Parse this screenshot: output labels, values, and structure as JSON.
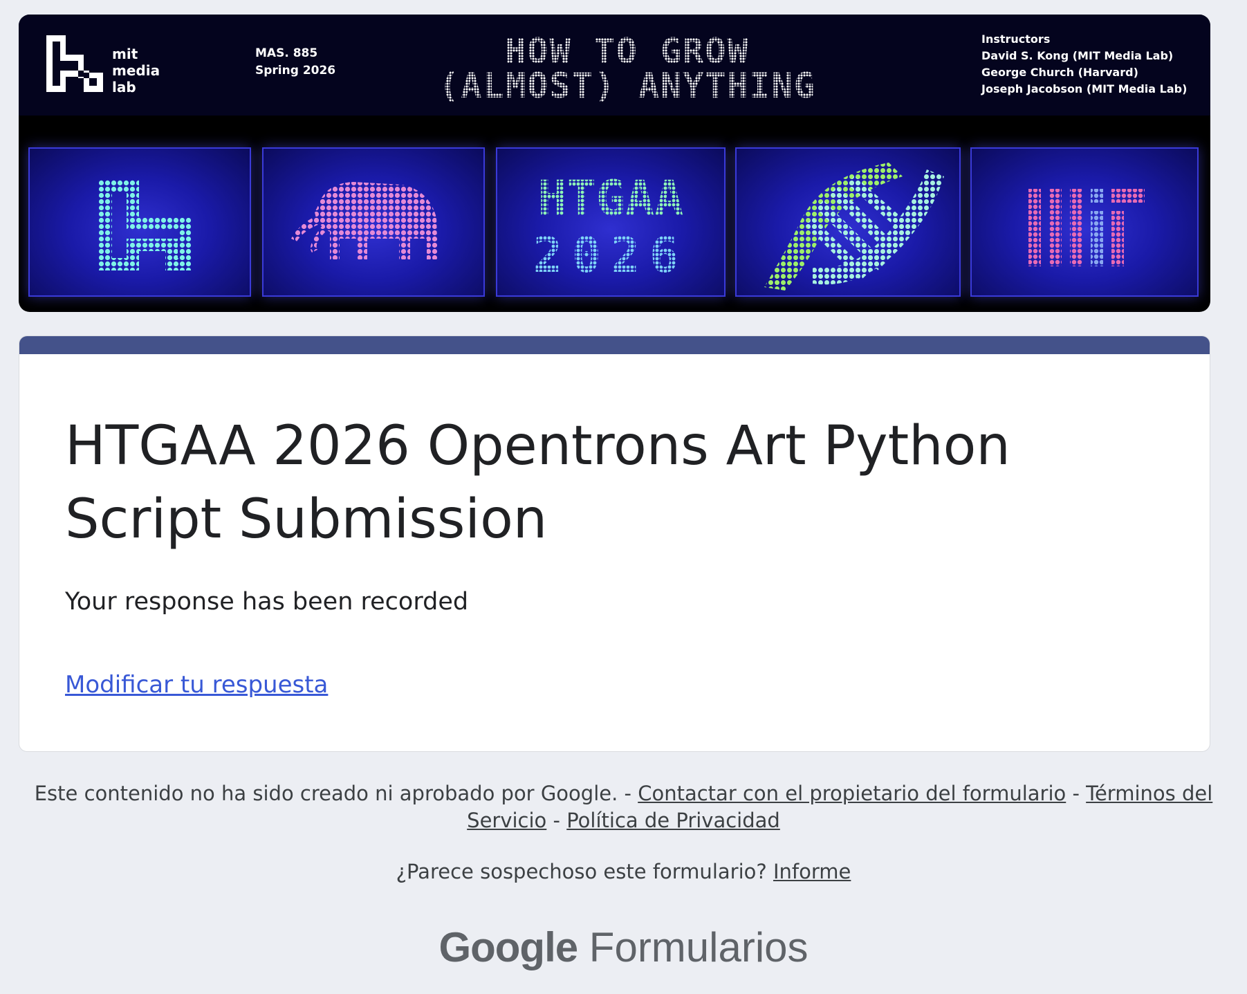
{
  "banner": {
    "logo_lines": [
      "mit",
      "media",
      "lab"
    ],
    "course_code": "MAS. 885",
    "course_term": "Spring 2026",
    "course_title_line1": "HOW TO GROW",
    "course_title_line2": "(ALMOST) ANYTHING",
    "instructors_label": "Instructors",
    "instructors": [
      "David S. Kong (MIT Media Lab)",
      "George Church (Harvard)",
      "Joseph Jacobson (MIT Media Lab)"
    ],
    "panel_text": {
      "htgaa": "HTGAA",
      "year": "2026",
      "mit": "MIT"
    }
  },
  "form": {
    "title": "HTGAA 2026 Opentrons Art Python Script Submission",
    "message": "Your response has been recorded",
    "edit_link": "Modificar tu respuesta",
    "accent_color": "#44528a",
    "link_color": "#3858d6"
  },
  "footer": {
    "disclaimer": "Este contenido no ha sido creado ni aprobado por Google. - ",
    "contact_link": "Contactar con el propietario del formulario",
    "sep": " - ",
    "terms_link": "Términos del Servicio",
    "privacy_link": "Política de Privacidad",
    "suspicious_text": "¿Parece sospechoso este formulario? ",
    "report_link": "Informe",
    "brand_google": "Google",
    "brand_product": "Formularios"
  }
}
